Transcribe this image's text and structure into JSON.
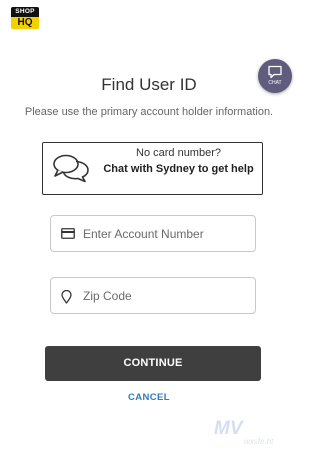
{
  "logo": {
    "top": "SHOP",
    "bottom": "HQ"
  },
  "chat_fab": {
    "label": "CHAT",
    "icon": "chat-bubble-icon"
  },
  "title": "Find User ID",
  "subtitle": "Please use the primary account holder information.",
  "chat_prompt": {
    "line1": "No card number?",
    "line2": "Chat with Sydney to get help",
    "icon": "chat-bubbles-icon"
  },
  "account_field": {
    "placeholder": "Enter Account Number",
    "value": "",
    "icon": "card-icon"
  },
  "zip_field": {
    "placeholder": "Zip Code",
    "value": "",
    "icon": "location-pin-icon"
  },
  "continue_label": "CONTINUE",
  "cancel_label": "CANCEL",
  "watermark": {
    "mark": "MV",
    "text": "wxsfe.ht"
  },
  "colors": {
    "primary_button": "#3f3f3f",
    "link": "#2e7bbd",
    "chat_fab": "#5f5c7d",
    "logo": "#f5d000"
  }
}
